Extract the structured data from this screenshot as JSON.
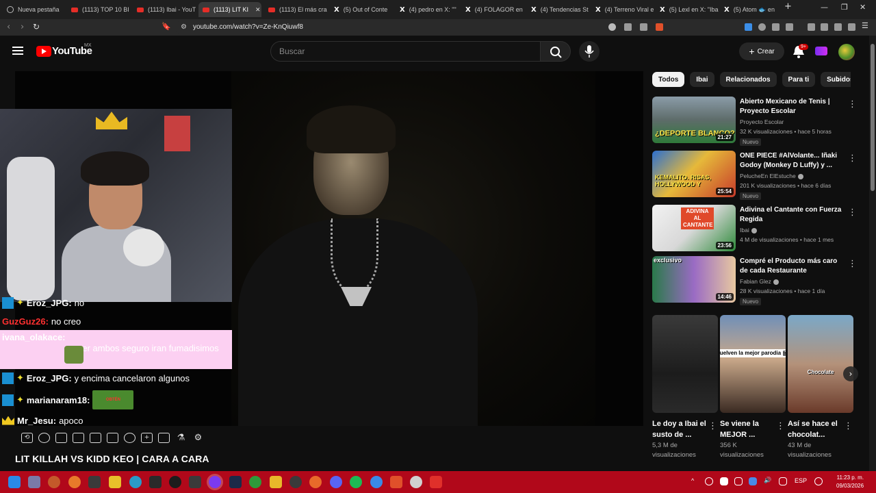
{
  "browser": {
    "tabs": [
      {
        "title": "Nueva pestaña",
        "favicon": "shield-icon"
      },
      {
        "title": "(1113) TOP 10 BI",
        "favicon": "youtube-icon"
      },
      {
        "title": "(1113) Ibai - YouT",
        "favicon": "youtube-icon"
      },
      {
        "title": "(1113) LIT KI",
        "favicon": "youtube-icon",
        "active": true
      },
      {
        "title": "(1113) El más cra",
        "favicon": "youtube-icon"
      },
      {
        "title": "(5) Out of Conte",
        "favicon": "x-icon"
      },
      {
        "title": "(4) pedro en X: \"\"",
        "favicon": "x-icon"
      },
      {
        "title": "(4) FOLAGOR en",
        "favicon": "x-icon"
      },
      {
        "title": "(4) Tendencias St",
        "favicon": "x-icon"
      },
      {
        "title": "(4) Terreno Viral e",
        "favicon": "x-icon"
      },
      {
        "title": "(5) Lexl en X: \"Iba",
        "favicon": "x-icon"
      },
      {
        "title": "(5) Atom 🐟 en",
        "favicon": "x-icon"
      }
    ],
    "url": "youtube.com/watch?v=Ze-KnQiuwf8",
    "new_tab": "+"
  },
  "youtube": {
    "logo_text": "YouTube",
    "region": "MX",
    "search_placeholder": "Buscar",
    "create_label": "Crear",
    "notifications_badge": "9+"
  },
  "overlay_chat": [
    {
      "user": "Eroz_JPG:",
      "message": "no",
      "user_color": "#ffffff",
      "badges": [
        "arrow",
        "star"
      ]
    },
    {
      "user": "GuzGuz26:",
      "message": "no creo",
      "user_color": "#ff3030",
      "badges": []
    },
    {
      "user": "ivana_olakace:",
      "message": "a ver ambos seguro iran fumadisimos",
      "user_color": "#ffffff",
      "badges": [],
      "highlighted": true
    },
    {
      "user": "Eroz_JPG:",
      "message": "y encima cancelaron algunos",
      "user_color": "#ffffff",
      "badges": [
        "arrow",
        "star"
      ]
    },
    {
      "user": "marianaram18:",
      "message": "",
      "user_color": "#ffffff",
      "badges": [
        "arrow",
        "star"
      ],
      "emote": "OBTÉN"
    },
    {
      "user": "Mr_Jesu:",
      "message": "apoco",
      "user_color": "#ffffff",
      "badges": [
        "crown"
      ]
    }
  ],
  "video": {
    "title": "LIT KILLAH VS KIDD KEO | CARA A CARA"
  },
  "chips": [
    "Todos",
    "Ibai",
    "Relacionados",
    "Para ti",
    "Subidos"
  ],
  "recommendations": [
    {
      "title": "Abierto Mexicano de Tenis | Proyecto Escolar",
      "channel": "Proyecto Escolar",
      "meta": "32 K visualizaciones • hace 5 horas",
      "duration": "21:27",
      "badge": "Nuevo",
      "thumb_text": "¿DEPORTE BLANCO?",
      "verified": false
    },
    {
      "title": "ONE PIECE #AlVolante... Iñaki Godoy (Monkey D Luffy) y ...",
      "channel": "PelucheEn ElEstuche",
      "meta": "201 K visualizaciones • hace 6 días",
      "duration": "25:54",
      "badge": "Nuevo",
      "thumb_text": "KEMALITO. RISAS, HOLLYWOOD Y",
      "verified": true
    },
    {
      "title": "Adivina el Cantante con Fuerza Regida",
      "channel": "Ibai",
      "meta": "4 M de visualizaciones • hace 1 mes",
      "duration": "23:56",
      "badge": "",
      "thumb_text": "ADIVINA AL CANTANTE",
      "verified": true
    },
    {
      "title": "Compré el Producto más caro de cada Restaurante",
      "channel": "Fabian Glez",
      "meta": "28 K visualizaciones • hace 1 día",
      "duration": "14:46",
      "badge": "Nuevo",
      "thumb_text": "exclusivo",
      "verified": true
    }
  ],
  "shorts": [
    {
      "title": "Le doy a Ibai el susto de ...",
      "views": "5,3 M de visualizaciones",
      "caption": ""
    },
    {
      "title": "Se viene la MEJOR ...",
      "views": "356 K visualizaciones",
      "caption": "Vuelven la mejor parodia 🎬"
    },
    {
      "title": "Así se hace el chocolat...",
      "views": "43 M de visualizaciones",
      "caption": "Chocolate"
    }
  ],
  "taskbar": {
    "language": "ESP",
    "time": "11:23 p. m.",
    "date": "09/03/2026"
  },
  "colors": {
    "youtube_red": "#ff0000",
    "taskbar": "#b1081a",
    "highlight_chat": "#fcd0f2"
  }
}
